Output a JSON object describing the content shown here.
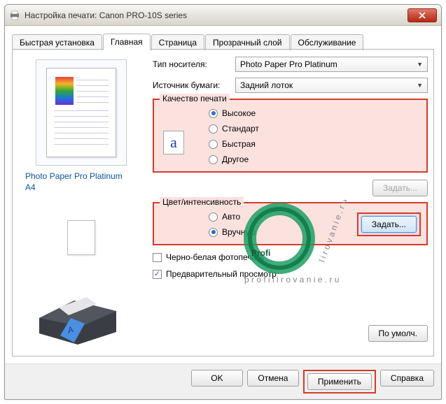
{
  "titlebar": {
    "title": "Настройка печати: Canon PRO-10S series"
  },
  "tabs": [
    "Быстрая установка",
    "Главная",
    "Страница",
    "Прозрачный слой",
    "Обслуживание"
  ],
  "active_tab": 1,
  "left": {
    "paper_name": "Photo Paper Pro Platinum",
    "paper_size": "A4"
  },
  "media": {
    "label": "Тип носителя:",
    "value": "Photo Paper Pro Platinum"
  },
  "source": {
    "label": "Источник бумаги:",
    "value": "Задний лоток"
  },
  "quality": {
    "legend": "Качество печати",
    "options": [
      "Высокое",
      "Стандарт",
      "Быстрая",
      "Другое"
    ],
    "selected": 0,
    "set_btn": "Задать..."
  },
  "color": {
    "legend": "Цвет/интенсивность",
    "options": [
      "Авто",
      "Вручную"
    ],
    "selected": 1,
    "set_btn": "Задать..."
  },
  "bw": {
    "label": "Черно-белая фотопечать",
    "checked": false
  },
  "preview": {
    "label": "Предварительный просмотр",
    "checked": true
  },
  "defaults_btn": "По умолч.",
  "buttons": {
    "ok": "OK",
    "cancel": "Отмена",
    "apply": "Применить",
    "help": "Справка"
  },
  "watermark": {
    "brand": "Profi",
    "domain": "profilirovanie.ru"
  }
}
